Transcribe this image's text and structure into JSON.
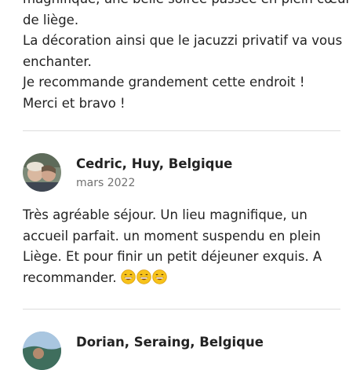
{
  "reviews": [
    {
      "lines": [
        "magnifique, une belle soirée passée en plein cœur",
        "de liège.",
        "La décoration ainsi que le jacuzzi privatif va vous",
        "enchanter.",
        "Je recommande grandement cette endroit !",
        " Merci et bravo !"
      ]
    },
    {
      "name": "Cedric, Huy, Belgique",
      "date": "mars 2022",
      "lines": [
        "Très agréable séjour.  Un lieu magnifique, un",
        "accueil parfait.  un moment suspendu en plein",
        "Liège.  Et pour finir un petit déjeuner exquis.  A",
        "recommander."
      ],
      "emoji": [
        "grinning-face-icon",
        "grinning-face-icon",
        "grinning-face-icon"
      ]
    },
    {
      "name": "Dorian, Seraing, Belgique"
    }
  ],
  "colors": {
    "text": "#222222",
    "secondary": "#717171",
    "divider": "#dddddd",
    "emoji": "#f7c31b"
  }
}
